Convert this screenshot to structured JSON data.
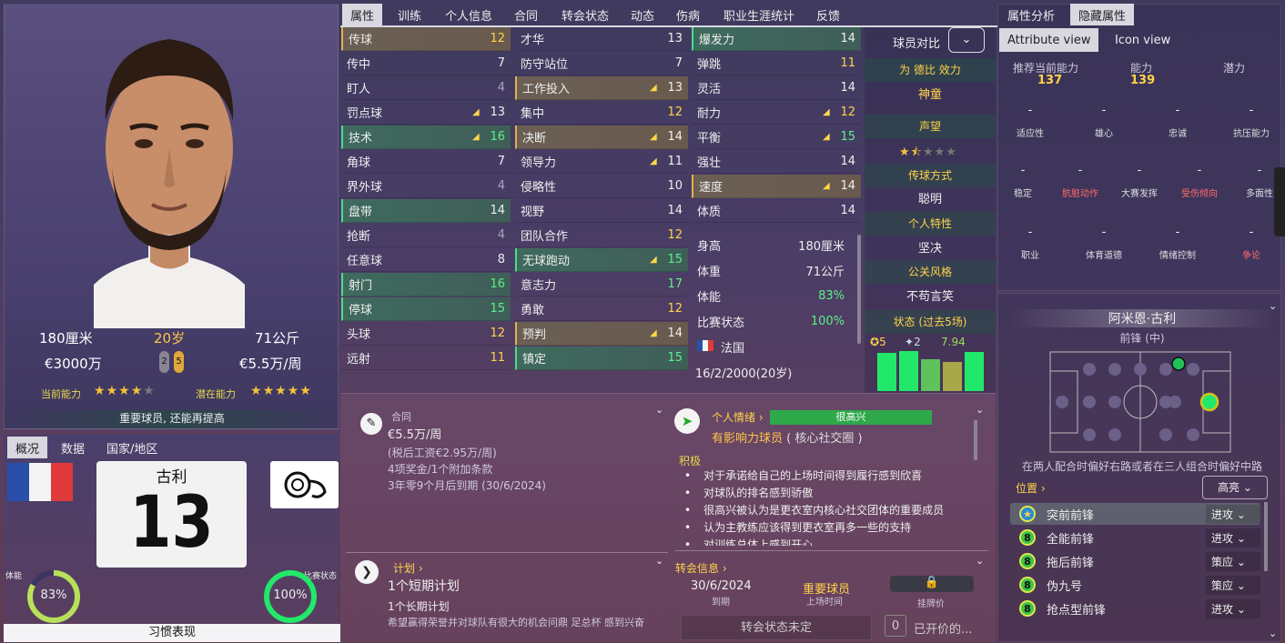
{
  "player": {
    "height": "180厘米",
    "age": "20岁",
    "weight": "71公斤",
    "value": "€3000万",
    "wage": "€5.5万/周",
    "foot_left": "2",
    "foot_right": "5",
    "current_ability_label": "当前能力",
    "potential_ability_label": "潜在能力",
    "current_stars": 4,
    "potential_stars": 5,
    "role_note": "重要球员, 还能再提高",
    "name_short": "古利",
    "number": "13",
    "condition_label": "体能",
    "condition_value": "83%",
    "match_sharpness_label": "比赛状态",
    "match_sharpness_value": "100%",
    "habits_button": "习惯表现"
  },
  "left_tabs": [
    "概况",
    "数据",
    "国家/地区"
  ],
  "top_tabs": [
    "属性",
    "训练",
    "个人信息",
    "合同",
    "转会状态",
    "动态",
    "伤病",
    "职业生涯统计",
    "反馈"
  ],
  "right_tabs": [
    "属性分析",
    "隐藏属性"
  ],
  "view_tabs": [
    "Attribute view",
    "Icon view"
  ],
  "technical": [
    {
      "name": "传球",
      "value": "12",
      "arrow": "",
      "hl": "gold",
      "vc": "vg"
    },
    {
      "name": "传中",
      "value": "7",
      "arrow": "",
      "hl": "",
      "vc": "vw"
    },
    {
      "name": "盯人",
      "value": "4",
      "arrow": "",
      "hl": "",
      "vc": "vd"
    },
    {
      "name": "罚点球",
      "value": "13",
      "arrow": "▲",
      "hl": "",
      "vc": "vw"
    },
    {
      "name": "技术",
      "value": "16",
      "arrow": "▲",
      "hl": "green",
      "vc": "vgr"
    },
    {
      "name": "角球",
      "value": "7",
      "arrow": "",
      "hl": "",
      "vc": "vw"
    },
    {
      "name": "界外球",
      "value": "4",
      "arrow": "",
      "hl": "",
      "vc": "vd"
    },
    {
      "name": "盘带",
      "value": "14",
      "arrow": "",
      "hl": "green",
      "vc": "vw"
    },
    {
      "name": "抢断",
      "value": "4",
      "arrow": "",
      "hl": "",
      "vc": "vd"
    },
    {
      "name": "任意球",
      "value": "8",
      "arrow": "",
      "hl": "",
      "vc": "vw"
    },
    {
      "name": "射门",
      "value": "16",
      "arrow": "",
      "hl": "green",
      "vc": "vgr"
    },
    {
      "name": "停球",
      "value": "15",
      "arrow": "",
      "hl": "green",
      "vc": "vgr"
    },
    {
      "name": "头球",
      "value": "12",
      "arrow": "",
      "hl": "",
      "vc": "vg"
    },
    {
      "name": "远射",
      "value": "11",
      "arrow": "",
      "hl": "",
      "vc": "vg"
    }
  ],
  "mental": [
    {
      "name": "才华",
      "value": "13",
      "arrow": "",
      "hl": "",
      "vc": "vw"
    },
    {
      "name": "防守站位",
      "value": "7",
      "arrow": "",
      "hl": "",
      "vc": "vw"
    },
    {
      "name": "工作投入",
      "value": "13",
      "arrow": "▲",
      "hl": "gold",
      "vc": "vw"
    },
    {
      "name": "集中",
      "value": "12",
      "arrow": "",
      "hl": "",
      "vc": "vg"
    },
    {
      "name": "决断",
      "value": "14",
      "arrow": "▲",
      "hl": "gold",
      "vc": "vw"
    },
    {
      "name": "领导力",
      "value": "11",
      "arrow": "▲",
      "hl": "",
      "vc": "vw"
    },
    {
      "name": "侵略性",
      "value": "10",
      "arrow": "",
      "hl": "",
      "vc": "vw"
    },
    {
      "name": "视野",
      "value": "14",
      "arrow": "",
      "hl": "",
      "vc": "vw"
    },
    {
      "name": "团队合作",
      "value": "12",
      "arrow": "",
      "hl": "",
      "vc": "vg"
    },
    {
      "name": "无球跑动",
      "value": "15",
      "arrow": "▲",
      "hl": "green",
      "vc": "vgr"
    },
    {
      "name": "意志力",
      "value": "17",
      "arrow": "",
      "hl": "",
      "vc": "vgr"
    },
    {
      "name": "勇敢",
      "value": "12",
      "arrow": "",
      "hl": "",
      "vc": "vg"
    },
    {
      "name": "预判",
      "value": "14",
      "arrow": "▲",
      "hl": "gold",
      "vc": "vw"
    },
    {
      "name": "镇定",
      "value": "15",
      "arrow": "",
      "hl": "green",
      "vc": "vgr"
    }
  ],
  "physical": [
    {
      "name": "爆发力",
      "value": "14",
      "arrow": "",
      "hl": "green",
      "vc": "vw"
    },
    {
      "name": "弹跳",
      "value": "11",
      "arrow": "",
      "hl": "",
      "vc": "vg"
    },
    {
      "name": "灵活",
      "value": "14",
      "arrow": "",
      "hl": "",
      "vc": "vw"
    },
    {
      "name": "耐力",
      "value": "12",
      "arrow": "▲",
      "hl": "",
      "vc": "vg"
    },
    {
      "name": "平衡",
      "value": "15",
      "arrow": "▲",
      "hl": "",
      "vc": "vgr"
    },
    {
      "name": "强壮",
      "value": "14",
      "arrow": "",
      "hl": "",
      "vc": "vw"
    },
    {
      "name": "速度",
      "value": "14",
      "arrow": "▲",
      "hl": "gold",
      "vc": "vw"
    },
    {
      "name": "体质",
      "value": "14",
      "arrow": "",
      "hl": "",
      "vc": "vw"
    }
  ],
  "bio": [
    {
      "label": "身高",
      "value": "180厘米",
      "vc": "vw"
    },
    {
      "label": "体重",
      "value": "71公斤",
      "vc": "vw"
    },
    {
      "label": "体能",
      "value": "83%",
      "vc": "vgr"
    },
    {
      "label": "比赛状态",
      "value": "100%",
      "vc": "vgr"
    }
  ],
  "nationality": "法国",
  "dob": "16/2/2000(20岁)",
  "side": {
    "compare_label": "球员对比",
    "plays_for": "为 德比 效力",
    "nickname": "神童",
    "reputation_label": "声望",
    "reputation_stars": 1.5,
    "passing_style_label": "传球方式",
    "passing_style": "聪明",
    "personality_label": "个人特性",
    "personality": "坚决",
    "media_label": "公关风格",
    "media": "不苟言笑",
    "form_label": "状态 (过去5场)",
    "goals": "5",
    "assists": "2",
    "rating": "7.94"
  },
  "form_bars": [
    {
      "h": 0.95,
      "c": "#22e86a"
    },
    {
      "h": 1.0,
      "c": "#22e86a"
    },
    {
      "h": 0.8,
      "c": "#5fc25a"
    },
    {
      "h": 0.72,
      "c": "#a8a84a"
    },
    {
      "h": 0.98,
      "c": "#22e86a"
    }
  ],
  "analysis": {
    "rec_ability_label": "推荐当前能力",
    "rec_ability": "137",
    "ability_label": "能力",
    "ability": "139",
    "potential_label": "潜力",
    "hidden_row1": [
      "适应性",
      "雄心",
      "忠诚",
      "抗压能力"
    ],
    "hidden_row2": [
      "稳定",
      "肮脏动作",
      "大赛发挥",
      "受伤倾向",
      "多面性"
    ],
    "hidden_row3": [
      "职业",
      "体育道德",
      "情绪控制",
      "争论"
    ]
  },
  "contract": {
    "label": "合同",
    "wage": "€5.5万/周",
    "after_tax": "(税后工资€2.95万/周)",
    "bonuses": "4项奖金/1个附加条款",
    "expiry": "3年零9个月后到期 (30/6/2024)"
  },
  "happiness": {
    "label": "个人情绪",
    "level": "很高兴",
    "influence": "有影响力球员",
    "influence_note": "( 核心社交圈 )",
    "positive_label": "积极",
    "items": [
      "对于承诺给自己的上场时间得到履行感到欣喜",
      "对球队的排名感到骄傲",
      "很高兴被认为是更衣室内核心社交团体的重要成员",
      "认为主教练应该得到更衣室再多一些的支持",
      "对训练总体上感到开心"
    ]
  },
  "plans": {
    "label": "计划",
    "short": "1个短期计划",
    "long": "1个长期计划",
    "note": "希望赢得荣誉并对球队有很大的机会问鼎 足总杯 感到兴奋"
  },
  "transfer": {
    "label": "转会信息",
    "expiry_date": "30/6/2024",
    "expiry_label": "到期",
    "playing_time": "重要球员",
    "playing_time_label": "上场时间",
    "price_label": "挂牌价",
    "status": "转会状态未定",
    "offers_count": "0",
    "offers_label": "已开价的..."
  },
  "positions": {
    "name": "阿米恩·古利",
    "role": "前锋 (中)",
    "note": "在两人配合时偏好右路或者在三人组合时偏好中路",
    "position_label": "位置",
    "highlight": "高亮",
    "roles": [
      {
        "name": "突前前锋",
        "duty": "进攻",
        "badge": "★"
      },
      {
        "name": "全能前锋",
        "duty": "进攻",
        "badge": "8"
      },
      {
        "name": "拖后前锋",
        "duty": "策应",
        "badge": "8"
      },
      {
        "name": "伪九号",
        "duty": "策应",
        "badge": "8"
      },
      {
        "name": "抢点型前锋",
        "duty": "进攻",
        "badge": "8"
      }
    ]
  },
  "colors": {
    "gold": "#ffd34a",
    "green": "#5df08a",
    "accent": "#dfe84a"
  }
}
